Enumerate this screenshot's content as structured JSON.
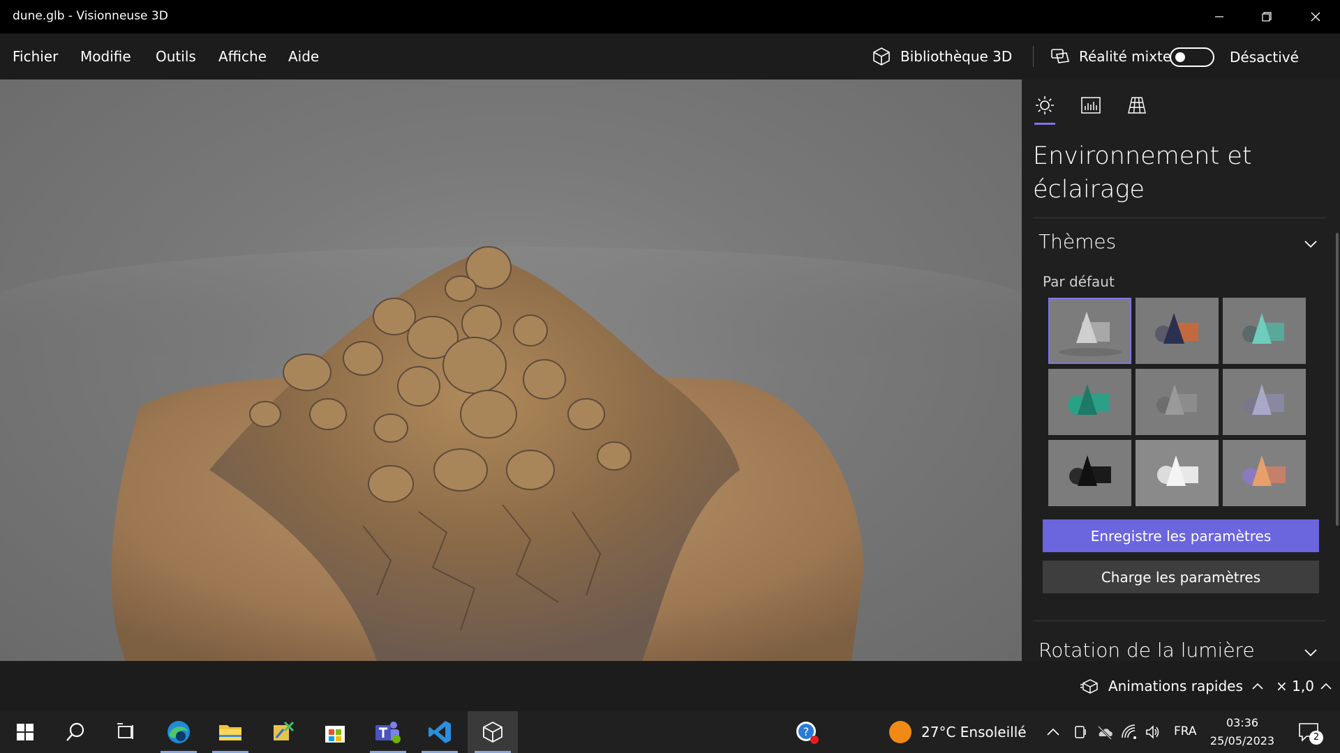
{
  "window": {
    "title": "dune.glb - Visionneuse 3D"
  },
  "menu": {
    "items": [
      "Fichier",
      "Modifie",
      "Outils",
      "Affiche",
      "Aide"
    ]
  },
  "header": {
    "library_label": "Bibliothèque 3D",
    "mixed_reality_label": "Réalité mixte",
    "mixed_reality_state": "Désactivé"
  },
  "panel": {
    "tabs": [
      "sun-icon",
      "stats-icon",
      "grid-icon"
    ],
    "title": "Environnement et éclairage",
    "themes_section": "Thèmes",
    "themes_subheading": "Par défaut",
    "save_button": "Enregistre les paramètres",
    "load_button": "Charge les paramètres",
    "light_rotation_section": "Rotation de la lumière",
    "colors": {
      "accent": "#6b65de",
      "selection": "#7d76e6"
    }
  },
  "status": {
    "animations_label": "Animations rapides",
    "speed_label": "× 1,0"
  },
  "taskbar": {
    "weather": "27°C  Ensoleillé",
    "language": "FRA",
    "time": "03:36",
    "date": "25/05/2023",
    "notifications": "2"
  }
}
